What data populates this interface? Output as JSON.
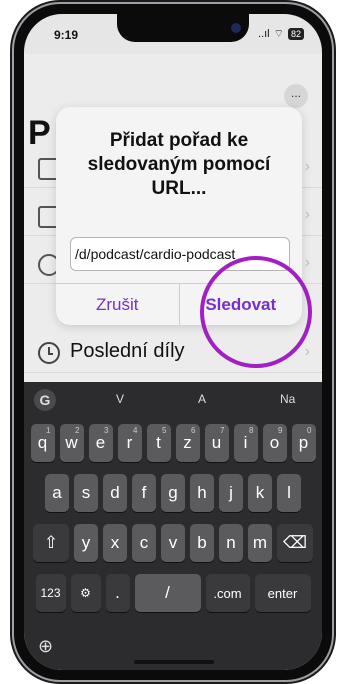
{
  "status": {
    "time": "9:19",
    "signal": "..ıl",
    "wifi": "⊗",
    "battery": "82"
  },
  "app": {
    "more_label": "...",
    "title_initial": "P",
    "last_row_label": "Poslední díly"
  },
  "dialog": {
    "title": "Přidat pořad ke sledovaným pomocí URL...",
    "url_value": "d/podcast/cardio-podcast/",
    "cancel_label": "Zrušit",
    "follow_label": "Sledovat"
  },
  "keyboard": {
    "suggestions": [
      "V",
      "A",
      "Na"
    ],
    "rows": [
      [
        {
          "k": "q",
          "s": "1"
        },
        {
          "k": "w",
          "s": "2"
        },
        {
          "k": "e",
          "s": "3"
        },
        {
          "k": "r",
          "s": "4"
        },
        {
          "k": "t",
          "s": "5"
        },
        {
          "k": "z",
          "s": "6"
        },
        {
          "k": "u",
          "s": "7"
        },
        {
          "k": "i",
          "s": "8"
        },
        {
          "k": "o",
          "s": "9"
        },
        {
          "k": "p",
          "s": "0"
        }
      ],
      [
        {
          "k": "a"
        },
        {
          "k": "s"
        },
        {
          "k": "d"
        },
        {
          "k": "f"
        },
        {
          "k": "g"
        },
        {
          "k": "h"
        },
        {
          "k": "j"
        },
        {
          "k": "k"
        },
        {
          "k": "l"
        }
      ],
      [
        {
          "k": "⇧"
        },
        {
          "k": "y"
        },
        {
          "k": "x"
        },
        {
          "k": "c"
        },
        {
          "k": "v"
        },
        {
          "k": "b"
        },
        {
          "k": "n"
        },
        {
          "k": "m"
        },
        {
          "k": "⌫"
        }
      ],
      [
        {
          "k": "123"
        },
        {
          "k": "⚙"
        },
        {
          "k": "."
        },
        {
          "k": "/"
        },
        {
          "k": ".com"
        },
        {
          "k": "enter"
        }
      ]
    ],
    "globe_icon": "globe-icon",
    "g_label": "G"
  },
  "colors": {
    "accent": "#7a2ec8",
    "highlight_circle": "#a21fc4"
  }
}
